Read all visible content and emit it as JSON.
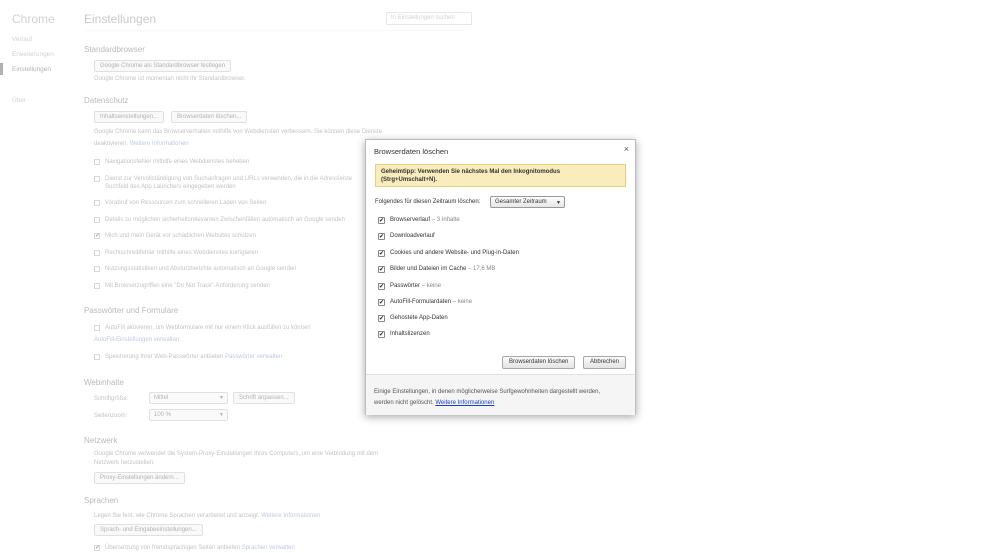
{
  "sidebar": {
    "brand": "Chrome",
    "items": [
      {
        "label": "Verlauf"
      },
      {
        "label": "Erweiterungen"
      },
      {
        "label": "Einstellungen"
      },
      {
        "label": "Über"
      }
    ]
  },
  "header": {
    "title": "Einstellungen",
    "search_placeholder": "In Einstellungen suchen"
  },
  "sections": {
    "default_browser": {
      "heading": "Standardbrowser",
      "button": "Google Chrome als Standardbrowser festlegen",
      "status": "Google Chrome ist momentan nicht Ihr Standardbrowser."
    },
    "privacy": {
      "heading": "Datenschutz",
      "content_settings_button": "Inhaltseinstellungen...",
      "clear_data_button": "Browserdaten löschen...",
      "desc_line1": "Google Chrome kann das Browserverhalten mithilfe von Webdiensten verbessern. Sie können diese Dienste",
      "desc_line2": "deaktivieren.",
      "more_info": "Weitere Informationen",
      "options": [
        {
          "label": "Navigationsfehler mithilfe eines Webdienstes beheben",
          "checked": false
        },
        {
          "label": "Dienst zur Vervollständigung von Suchanfragen und URLs verwenden, die in die Adressleiste",
          "checked": false
        },
        {
          "label": "Suchfeld des App Launchers eingegeben werden",
          "checked": false
        },
        {
          "label": "Vorabruf von Ressourcen zum schnelleren Laden von Seiten",
          "checked": false
        },
        {
          "label": "Details zu möglichen sicherheitsrelevanten Zwischenfällen automatisch an Google senden",
          "checked": false
        },
        {
          "label": "Mich und mein Gerät vor schädlichen Websites schützen",
          "checked": true
        },
        {
          "label": "Rechtschreibfehler mithilfe eines Webdienstes korrigieren",
          "checked": false
        },
        {
          "label": "Nutzungsstatistiken und Absturzberichte automatisch an Google senden",
          "checked": false
        },
        {
          "label": "Mit Browserzugriffen eine \"Do Not Track\"-Anforderung senden",
          "checked": false
        }
      ]
    },
    "passwords": {
      "heading": "Passwörter und Formulare",
      "autofill_label": "AutoFill aktivieren, um Webformulare mit nur einem Klick ausfüllen zu können",
      "autofill_link": "AutoFill-Einstellungen verwalten",
      "save_pw_label": "Speicherung Ihrer Web-Passwörter anbieten",
      "save_pw_link": "Passwörter verwalten"
    },
    "web_content": {
      "heading": "Webinhalte",
      "font_size_label": "Schriftgröße:",
      "font_size_value": "Mittel",
      "customize_fonts_button": "Schrift anpassen...",
      "zoom_label": "Seitenzoom:",
      "zoom_value": "100 %"
    },
    "network": {
      "heading": "Netzwerk",
      "desc_line1": "Google Chrome verwendet die System-Proxy-Einstellungen Ihres Computers, um eine Verbindung mit dem",
      "desc_line2": "Netzwerk herzustellen.",
      "proxy_button": "Proxy-Einstellungen ändern..."
    },
    "languages": {
      "heading": "Sprachen",
      "desc": "Legen Sie fest, wie Chrome Sprachen verarbeitet und anzeigt.",
      "more_info": "Weitere Informationen",
      "lang_button": "Sprach- und Eingabeeinstellungen...",
      "translate_label": "Übersetzung von fremdsprachigen Seiten anbieten",
      "translate_link": "Sprachen verwalten"
    }
  },
  "dialog": {
    "title": "Browserdaten löschen",
    "close": "×",
    "tip_line1": "Geheimtipp: Verwenden Sie nächstes Mal den Inkognitomodus",
    "tip_line2": "(Strg+Umschalt+N).",
    "range_label": "Folgendes für diesen Zeitraum löschen:",
    "range_value": "Gesamter Zeitraum",
    "options": [
      {
        "label": "Browserverlauf",
        "detail": "– 3 Inhalte",
        "checked": true
      },
      {
        "label": "Downloadverlauf",
        "detail": "",
        "checked": true
      },
      {
        "label": "Cookies und andere Website- und Plug-in-Daten",
        "detail": "",
        "checked": true
      },
      {
        "label": "Bilder und Dateien im Cache",
        "detail": "– 17,6 MB",
        "checked": true
      },
      {
        "label": "Passwörter",
        "detail": "– keine",
        "checked": true
      },
      {
        "label": "AutoFill-Formulardaten",
        "detail": "– keine",
        "checked": true
      },
      {
        "label": "Gehostete App-Daten",
        "detail": "",
        "checked": true
      },
      {
        "label": "Inhaltslizenzen",
        "detail": "",
        "checked": true
      }
    ],
    "clear_button": "Browserdaten löschen",
    "cancel_button": "Abbrechen",
    "footer_line1": "Einige Einstellungen, in denen möglicherweise Surfgewohnheiten dargestellt werden,",
    "footer_line2": "werden nicht gelöscht.",
    "footer_link": "Weitere Informationen"
  },
  "icons": {
    "check": "✔",
    "dropdown": "▼"
  }
}
